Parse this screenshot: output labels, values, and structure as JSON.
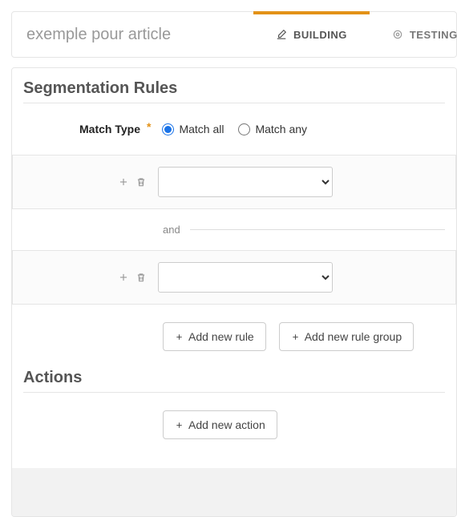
{
  "header": {
    "title_placeholder": "exemple pour article",
    "tabs": [
      {
        "label": "BUILDING",
        "active": true
      },
      {
        "label": "TESTING",
        "active": false
      }
    ]
  },
  "segmentation": {
    "title": "Segmentation Rules",
    "match_type_label": "Match Type",
    "required_marker": "*",
    "options": {
      "all": "Match all",
      "any": "Match any"
    },
    "selected_option": "all",
    "connector": "and",
    "buttons": {
      "add_rule": "Add new rule",
      "add_group": "Add new rule group"
    }
  },
  "actions": {
    "title": "Actions",
    "buttons": {
      "add_action": "Add new action"
    }
  }
}
